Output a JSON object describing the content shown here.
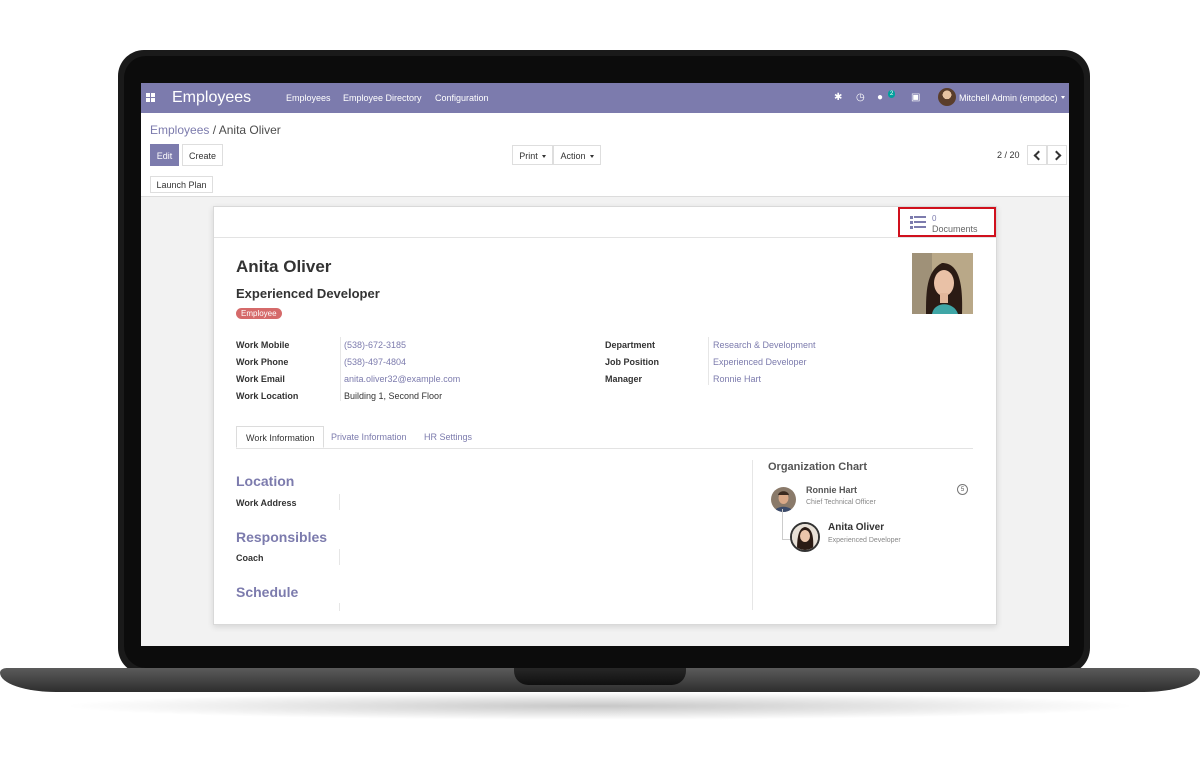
{
  "navbar": {
    "app_name": "Employees",
    "menu": [
      "Employees",
      "Employee Directory",
      "Configuration"
    ],
    "chat_badge": "2",
    "user": "Mitchell Admin (empdoc)"
  },
  "breadcrumb": {
    "parent": "Employees",
    "separator": "/",
    "current": "Anita Oliver"
  },
  "toolbar": {
    "edit": "Edit",
    "create": "Create",
    "print": "Print",
    "action": "Action",
    "launch_plan": "Launch Plan"
  },
  "pager": {
    "value": "2 / 20"
  },
  "smart_button": {
    "count": "0",
    "label": "Documents"
  },
  "employee": {
    "name": "Anita Oliver",
    "job_title": "Experienced Developer",
    "tag": "Employee"
  },
  "fields_left": [
    {
      "label": "Work Mobile",
      "value": "(538)-672-3185"
    },
    {
      "label": "Work Phone",
      "value": "(538)-497-4804"
    },
    {
      "label": "Work Email",
      "value": "anita.oliver32@example.com"
    },
    {
      "label": "Work Location",
      "value": "Building 1, Second Floor"
    }
  ],
  "fields_right": [
    {
      "label": "Department",
      "value": "Research & Development"
    },
    {
      "label": "Job Position",
      "value": "Experienced Developer"
    },
    {
      "label": "Manager",
      "value": "Ronnie Hart"
    }
  ],
  "tabs": [
    "Work Information",
    "Private Information",
    "HR Settings"
  ],
  "sections": [
    {
      "title": "Location",
      "field": "Work Address"
    },
    {
      "title": "Responsibles",
      "field": "Coach"
    },
    {
      "title": "Schedule"
    }
  ],
  "org_chart": {
    "title": "Organization Chart",
    "manager_name": "Ronnie Hart",
    "manager_job": "Chief Technical Officer",
    "manager_count": "5",
    "self_name": "Anita Oliver",
    "self_job": "Experienced Developer"
  },
  "colors": {
    "brand": "#7c7bad",
    "highlight": "#d0101d",
    "tag": "#d56a6a"
  }
}
